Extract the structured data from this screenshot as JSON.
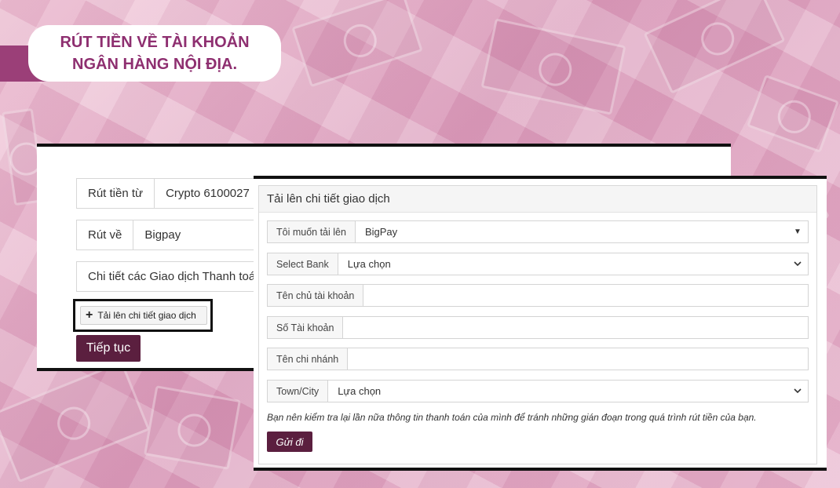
{
  "banner": {
    "line1": "RÚT TIỀN VỀ TÀI KHOẢN",
    "line2": "NGÂN HÀNG NỘI ĐỊA."
  },
  "back_form": {
    "withdraw_from_label": "Rút tiền từ",
    "withdraw_from_value": "Crypto 6100027",
    "withdraw_to_label": "Rút về",
    "withdraw_to_value": "Bigpay",
    "details_label": "Chi tiết các Giao dịch Thanh toán",
    "upload_button": "Tải lên chi tiết giao dịch",
    "continue_button": "Tiếp tục"
  },
  "modal": {
    "title": "Tải lên chi tiết giao dịch",
    "fields": {
      "upload_method": {
        "label": "Tôi muốn tải lên",
        "value": "BigPay"
      },
      "bank": {
        "label": "Select Bank",
        "value": "Lựa chọn"
      },
      "account_holder": {
        "label": "Tên chủ tài khoản",
        "value": ""
      },
      "account_number": {
        "label": "Số Tài khoản",
        "value": ""
      },
      "branch": {
        "label": "Tên chi nhánh",
        "value": ""
      },
      "town": {
        "label": "Town/City",
        "value": "Lựa chọn"
      }
    },
    "note": "Bạn nên kiểm tra lại lần nữa thông tin thanh toán của mình để tránh những gián đoạn trong quá trình rút tiền của bạn.",
    "submit_button": "Gửi đi"
  },
  "colors": {
    "brand": "#8e2f70",
    "button": "#5b1f3f"
  }
}
